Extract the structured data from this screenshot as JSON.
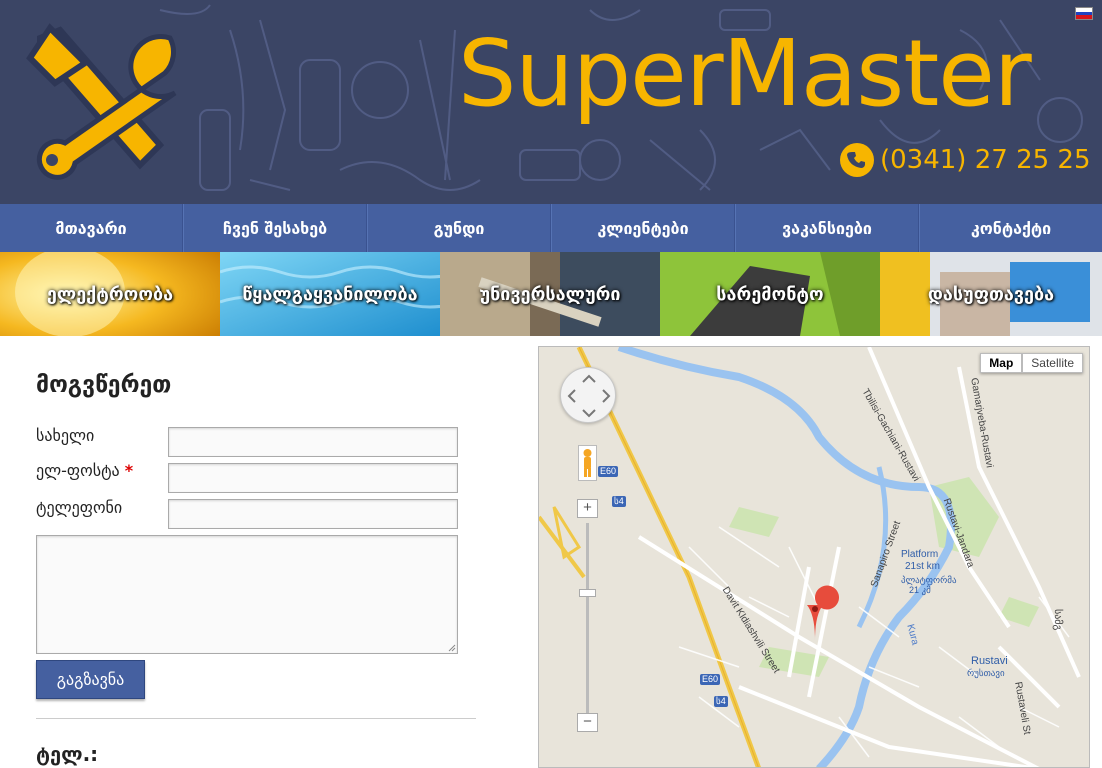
{
  "header": {
    "brand": "SuperMaster",
    "phone": "(0341) 27 25 25"
  },
  "nav": {
    "items": [
      {
        "label": "მთავარი"
      },
      {
        "label": "ჩვენ შესახებ"
      },
      {
        "label": "გუნდი"
      },
      {
        "label": "კლიენტები"
      },
      {
        "label": "ვაკანსიები"
      },
      {
        "label": "კონტაქტი"
      }
    ]
  },
  "services": [
    {
      "label": "ელექტროობა"
    },
    {
      "label": "წყალგაყვანილობა"
    },
    {
      "label": "უნივერსალური"
    },
    {
      "label": "სარემონტო"
    },
    {
      "label": "დასუფთავება"
    }
  ],
  "form": {
    "title": "მოგვწერეთ",
    "name_label": "სახელი",
    "email_label": "ელ-ფოსტა",
    "required_mark": "*",
    "phone_label": "ტელეფონი",
    "submit_label": "გაგზავნა",
    "tel_heading": "ტელ.:"
  },
  "map": {
    "type_map": "Map",
    "type_satellite": "Satellite",
    "zoom_in": "+",
    "zoom_out": "−",
    "labels": {
      "tbilisi_road": "Tbilisi-Gachiani-Rustavi",
      "gamariyeba": "Gamarjveba-Rustavi",
      "rustavi_jandara": "Rustavi-Jandara",
      "platform": "Platform",
      "platform_km": "21st km",
      "platform_geo": "პლატფორმა",
      "platform_geo_km": "21 კმ",
      "david": "Davit Kldiashvili Street",
      "sanapiro": "Sanapiro Street",
      "rustavi": "Rustavi",
      "rustavi_geo": "რუსთავი",
      "rustaveli": "Rustaveli St",
      "kura": "Kura",
      "e60a": "E60",
      "e60b": "E60",
      "s4a": "ს4",
      "s4b": "ს4",
      "samgori": "სამგ"
    }
  }
}
